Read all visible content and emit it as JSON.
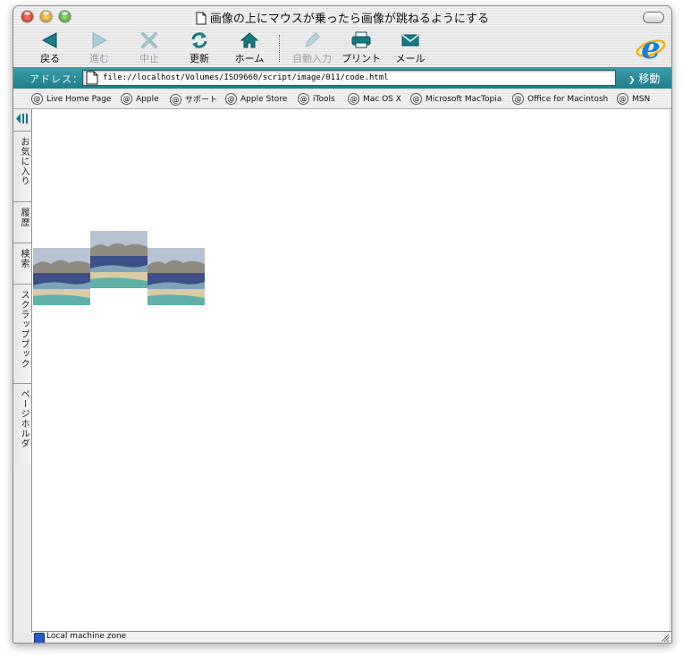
{
  "window": {
    "title": "画像の上にマウスが乗ったら画像が跳ねるようにする"
  },
  "toolbar": {
    "back": "戻る",
    "forward": "進む",
    "stop": "中止",
    "refresh": "更新",
    "home": "ホーム",
    "autofill": "自動入力",
    "print": "プリント",
    "mail": "メール"
  },
  "address": {
    "label": "アドレス：",
    "value": "file://localhost/Volumes/ISO9660/script/image/011/code.html",
    "go": "移動"
  },
  "favorites": [
    "Live Home Page",
    "Apple",
    "サポート",
    "Apple Store",
    "iTools",
    "Mac OS X",
    "Microsoft MacTopia",
    "Office for Macintosh",
    "MSN"
  ],
  "sidebar": {
    "tabs": [
      "お気に入り",
      "履歴",
      "検索",
      "スクラップブック",
      "ページホルダ"
    ]
  },
  "status": {
    "zone": "Local machine zone"
  },
  "colors": {
    "accent": "#1e8a96",
    "brand_ie": "#1a7fd0"
  }
}
